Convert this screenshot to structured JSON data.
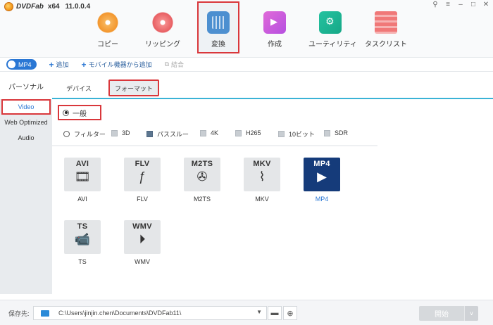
{
  "app": {
    "brand": "DVDFab",
    "arch": "x64",
    "version": "11.0.0.4"
  },
  "window_controls": [
    "pin-icon",
    "menu-icon",
    "minimize-icon",
    "maximize-icon",
    "close-icon"
  ],
  "modes": [
    {
      "label": "コピー",
      "icon": "copy-disc-icon"
    },
    {
      "label": "リッピング",
      "icon": "ripper-disc-icon"
    },
    {
      "label": "変換",
      "icon": "converter-film-icon",
      "active": true
    },
    {
      "label": "作成",
      "icon": "creator-icon"
    },
    {
      "label": "ユーティリティ",
      "icon": "utility-icon"
    },
    {
      "label": "タスクリスト",
      "icon": "task-list-icon"
    }
  ],
  "subbar": {
    "profile": "MP4",
    "add": "追加",
    "add_mobile": "モバイル機器から追加",
    "merge": "結合"
  },
  "tabs": {
    "personal": "パーソナル",
    "device": "デバイス",
    "format": "フォーマット"
  },
  "leftnav": {
    "items": [
      "Video",
      "Web Optimized",
      "Audio"
    ],
    "selected": "Video"
  },
  "quality": {
    "general": "一般",
    "filter": "フィルター"
  },
  "filters": [
    {
      "label": "3D",
      "checked": false
    },
    {
      "label": "パススルー",
      "checked": true
    },
    {
      "label": "4K",
      "checked": false
    },
    {
      "label": "H265",
      "checked": false
    },
    {
      "label": "10ビット",
      "checked": false
    },
    {
      "label": "SDR",
      "checked": false
    }
  ],
  "formats": [
    {
      "tag": "AVI",
      "name": "AVI",
      "glyph": "film-strip-icon"
    },
    {
      "tag": "FLV",
      "name": "FLV",
      "glyph": "flash-icon"
    },
    {
      "tag": "M2TS",
      "name": "M2TS",
      "glyph": "film-reel-icon"
    },
    {
      "tag": "MKV",
      "name": "MKV",
      "glyph": "mkv-icon"
    },
    {
      "tag": "MP4",
      "name": "MP4",
      "glyph": "play-icon",
      "selected": true
    },
    {
      "tag": "TS",
      "name": "TS",
      "glyph": "camera-icon"
    },
    {
      "tag": "WMV",
      "name": "WMV",
      "glyph": "play-circle-icon"
    }
  ],
  "footer": {
    "save_label": "保存先:",
    "path": "C:\\Users\\jinjin.chen\\Documents\\DVDFab11\\",
    "start": "開始"
  }
}
